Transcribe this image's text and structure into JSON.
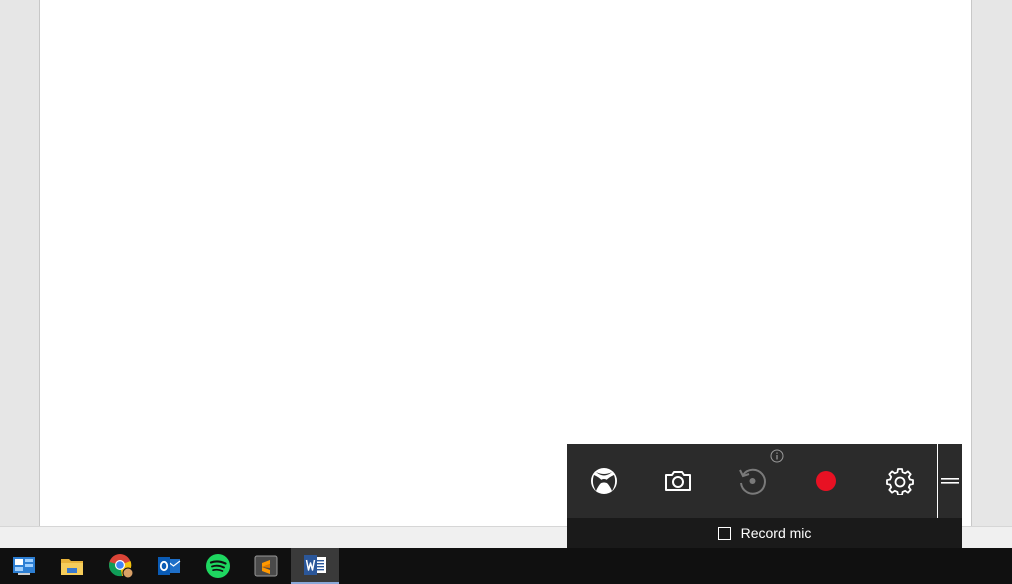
{
  "gamebar": {
    "record_mic_label": "Record mic",
    "record_mic_checked": false,
    "buttons": [
      "xbox-icon",
      "camera-icon",
      "record-last-icon",
      "record-icon",
      "gear-icon"
    ],
    "record_color": "#e81123"
  },
  "taskbar": {
    "apps": [
      "control-panel-icon",
      "file-explorer-icon",
      "chrome-icon",
      "outlook-icon",
      "spotify-icon",
      "sublime-text-icon",
      "word-icon"
    ],
    "active_app": "word-icon"
  }
}
